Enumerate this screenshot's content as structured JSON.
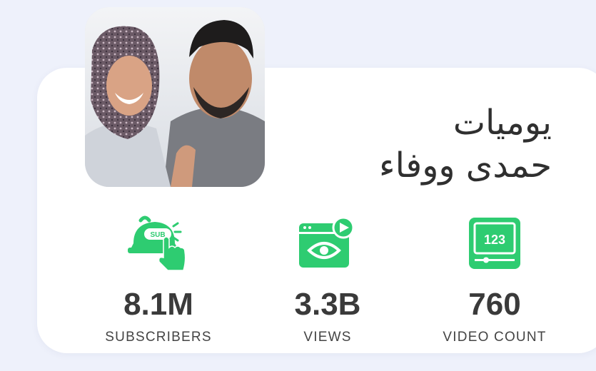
{
  "channel": {
    "name_line1": "يوميات",
    "name_line2": "حمدى ووفاء"
  },
  "stats": [
    {
      "value": "8.1M",
      "label": "SUBSCRIBERS",
      "icon": "subscribe-bell-icon"
    },
    {
      "value": "3.3B",
      "label": "VIEWS",
      "icon": "video-views-icon"
    },
    {
      "value": "760",
      "label": "VIDEO COUNT",
      "icon": "video-count-icon"
    }
  ],
  "colors": {
    "accent": "#2ecc71",
    "background": "#eef1fb",
    "card": "#ffffff",
    "text": "#3a3a3a"
  }
}
